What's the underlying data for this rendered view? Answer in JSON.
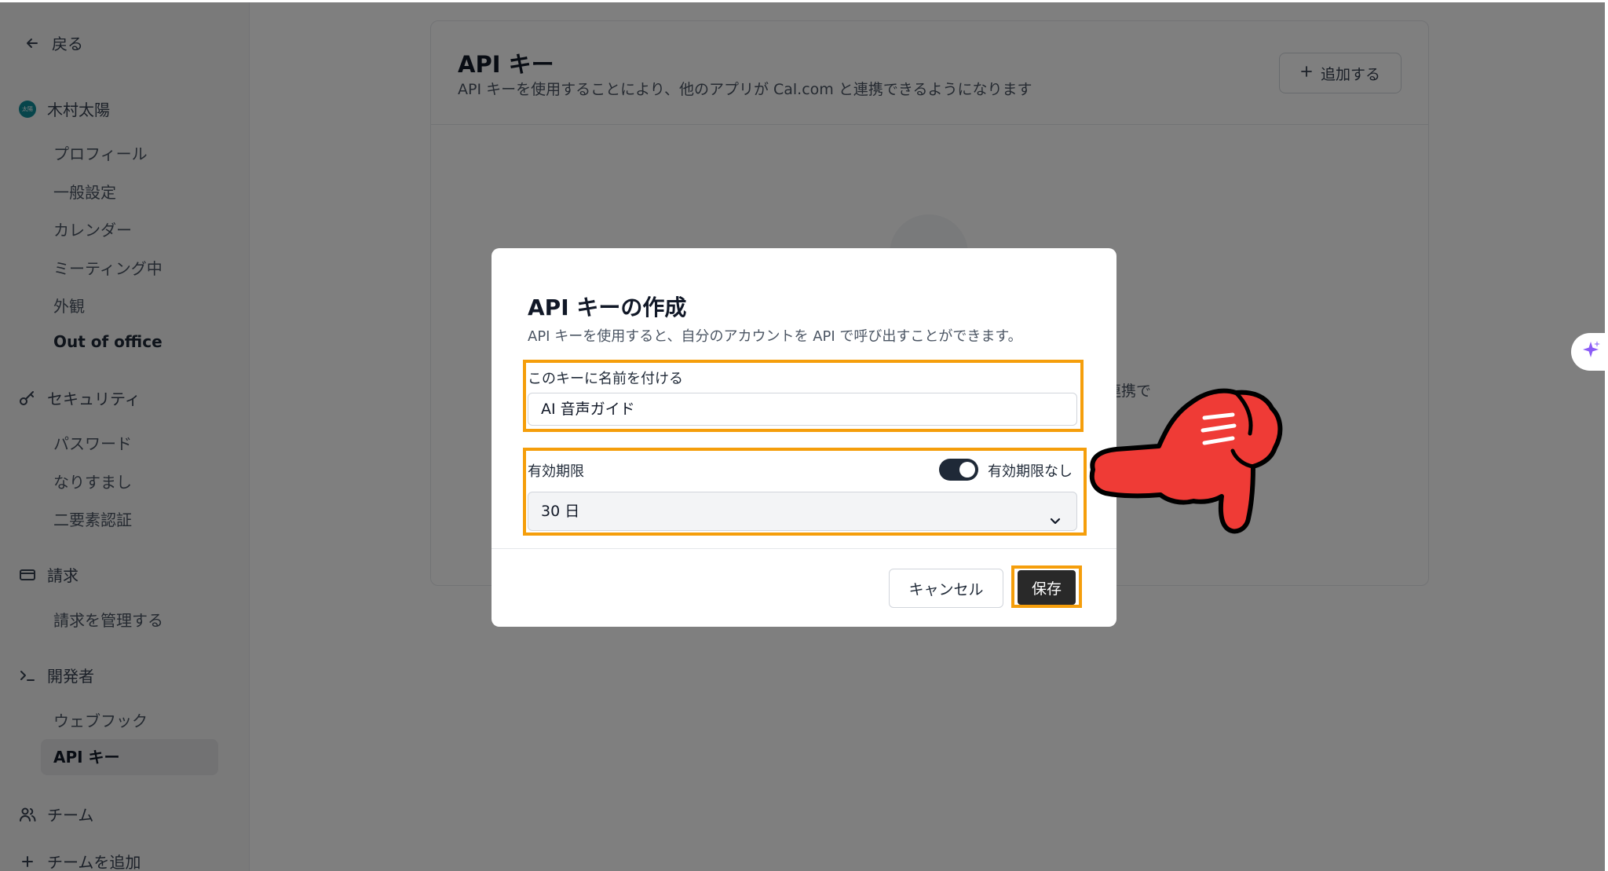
{
  "sidebar": {
    "back_label": "戻る",
    "user": {
      "avatar_text": "太陽",
      "name": "木村太陽"
    },
    "profile_items": [
      "プロフィール",
      "一般設定",
      "カレンダー",
      "ミーティング中",
      "外観",
      "Out of office"
    ],
    "security": {
      "label": "セキュリティ",
      "items": [
        "パスワード",
        "なりすまし",
        "二要素認証"
      ]
    },
    "billing": {
      "label": "請求",
      "items": [
        "請求を管理する"
      ]
    },
    "developer": {
      "label": "開発者",
      "items": [
        "ウェブフック",
        "API キー"
      ]
    },
    "team": {
      "label": "チーム",
      "add_label": "チームを追加"
    }
  },
  "main": {
    "title": "API キー",
    "subtitle": "API キーを使用することにより、他のアプリが Cal.com と連携できるようになります",
    "add_button": "追加する",
    "peek_text": "連携で"
  },
  "modal": {
    "title": "API キーの作成",
    "description": "API キーを使用すると、自分のアカウントを API で呼び出すことができます。",
    "name_label": "このキーに名前を付ける",
    "name_value": "AI 音声ガイド",
    "expiry_label": "有効期限",
    "toggle_label": "有効期限なし",
    "toggle_on": true,
    "expiry_value": "30 日",
    "cancel_label": "キャンセル",
    "save_label": "保存"
  },
  "colors": {
    "highlight": "#f59e0b",
    "pointer": "#ef3b36",
    "overlay": "rgba(0,0,0,0.5)"
  }
}
